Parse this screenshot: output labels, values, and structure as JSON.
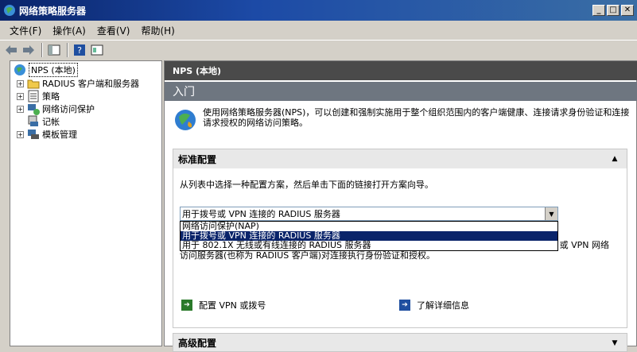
{
  "window": {
    "title": "网络策略服务器"
  },
  "menu": [
    "文件(F)",
    "操作(A)",
    "查看(V)",
    "帮助(H)"
  ],
  "tree": {
    "root": "NPS (本地)",
    "items": [
      {
        "label": "RADIUS 客户端和服务器"
      },
      {
        "label": "策略"
      },
      {
        "label": "网络访问保护"
      },
      {
        "label": "记帐"
      },
      {
        "label": "模板管理"
      }
    ]
  },
  "right": {
    "header": "NPS (本地)",
    "intro_title": "入门",
    "intro_text": "使用网络策略服务器(NPS)，可以创建和强制实施用于整个组织范围内的客户端健康、连接请求身份验证和连接请求授权的网络访问策略。",
    "standard": {
      "title": "标准配置",
      "instruction": "从列表中选择一种配置方案，然后单击下面的链接打开方案向导。",
      "combo_value": "用于拨号或 VPN 连接的 RADIUS 服务器",
      "options": [
        "网络访问保护(NAP)",
        "用于拨号或 VPN 连接的 RADIUS 服务器",
        "用于 802.1X 无线或有线连接的 RADIUS 服务器"
      ],
      "desc_line1": "或 VPN 网络",
      "desc_line2": "访问服务器(也称为 RADIUS 客户端)对连接执行身份验证和授权。",
      "link_configure": "配置 VPN 或拨号",
      "link_more": "了解详细信息"
    },
    "advanced": {
      "title": "高级配置"
    }
  }
}
